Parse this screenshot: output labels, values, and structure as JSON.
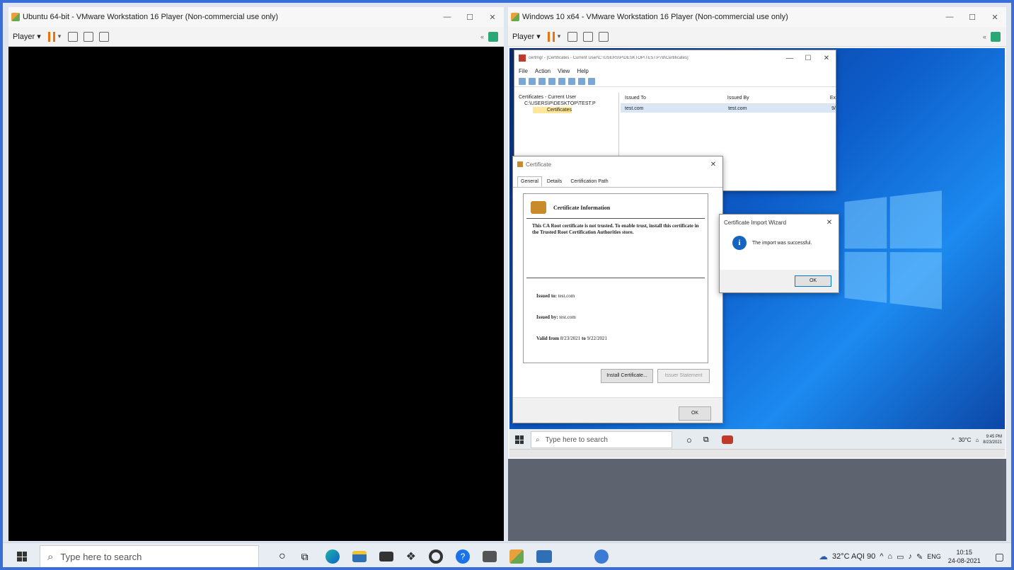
{
  "host": {
    "left_window": {
      "title": "Ubuntu 64-bit - VMware Workstation 16 Player (Non-commercial use only)",
      "player_label": "Player"
    },
    "right_window": {
      "title": "Windows 10 x64 - VMware Workstation 16 Player (Non-commercial use only)",
      "player_label": "Player"
    },
    "taskbar": {
      "search_placeholder": "Type here to search",
      "weather": "32°C AQI 90",
      "lang": "ENG",
      "time": "10:15",
      "date": "24-08-2021"
    }
  },
  "guest": {
    "mmc": {
      "title": "certmgr - [Certificates - Current User\\C:\\USERS\\P\\DESKTOP\\TEST.P7B\\Certificates]",
      "menu": [
        "File",
        "Action",
        "View",
        "Help"
      ],
      "tree": [
        "Certificates - Current User",
        "C:\\USERS\\P\\DESKTOP\\TEST.P",
        "Certificates"
      ],
      "columns": [
        "Issued To",
        "Issued By",
        "Ex"
      ],
      "row": {
        "issued_to": "test.com",
        "issued_by": "test.com",
        "ex": "9/"
      }
    },
    "cert": {
      "title": "Certificate",
      "tabs": [
        "General",
        "Details",
        "Certification Path"
      ],
      "heading": "Certificate Information",
      "warning": "This CA Root certificate is not trusted. To enable trust, install this certificate in the Trusted Root Certification Authorities store.",
      "issued_to_label": "Issued to:",
      "issued_to": "test.com",
      "issued_by_label": "Issued by:",
      "issued_by": "test.com",
      "valid_from_label": "Valid from",
      "valid_from": "8/23/2021",
      "to_label": "to",
      "valid_to": "9/22/2021",
      "install_btn": "Install Certificate...",
      "issuer_btn": "Issuer Statement",
      "ok_btn": "OK"
    },
    "wizard": {
      "title": "Certificate Import Wizard",
      "message": "The import was successful.",
      "ok_btn": "OK"
    },
    "taskbar": {
      "search_placeholder": "Type here to search",
      "weather": "30°C",
      "time": "9:45 PM",
      "date": "8/23/2021"
    }
  }
}
